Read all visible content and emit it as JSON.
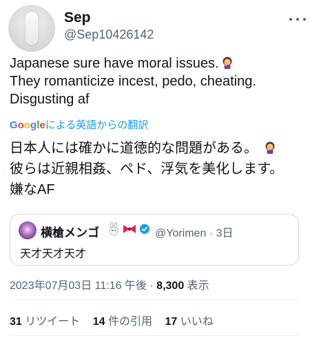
{
  "author": {
    "display_name": "Sep",
    "handle": "@Sep10426142"
  },
  "tweet": {
    "lines": [
      "Japanese sure have moral issues.",
      "They romanticize incest, pedo, cheating.",
      "Disgusting af"
    ],
    "emoji": "woman-facepalming-emoji"
  },
  "translation": {
    "link_brand": "Google",
    "link_text": "による英語からの翻訳",
    "lines": [
      "日本人には確かに道徳的な問題がある。",
      "彼らは近親相姦、ペド、浮気を美化します。",
      "嫌なAF"
    ]
  },
  "quoted_tweet": {
    "display_name": "横槍メンゴ",
    "badges": [
      "rabbit-emoji",
      "ribbon-emoji"
    ],
    "handle": "@Yorimen",
    "age": "3日",
    "text": "天才天才天才"
  },
  "meta": {
    "timestamp": "2023年07月03日 11:16 午後",
    "separator": "·",
    "views_count": "8,300",
    "views_label": "表示"
  },
  "stats": {
    "retweets_count": "31",
    "retweets_label": "リツイート",
    "quotes_count": "14",
    "quotes_label": "件の引用",
    "likes_count": "17",
    "likes_label": "いいね"
  },
  "colors": {
    "accent": "#1d9bf0",
    "secondary_text": "#536471",
    "border": "#cfd9de"
  }
}
